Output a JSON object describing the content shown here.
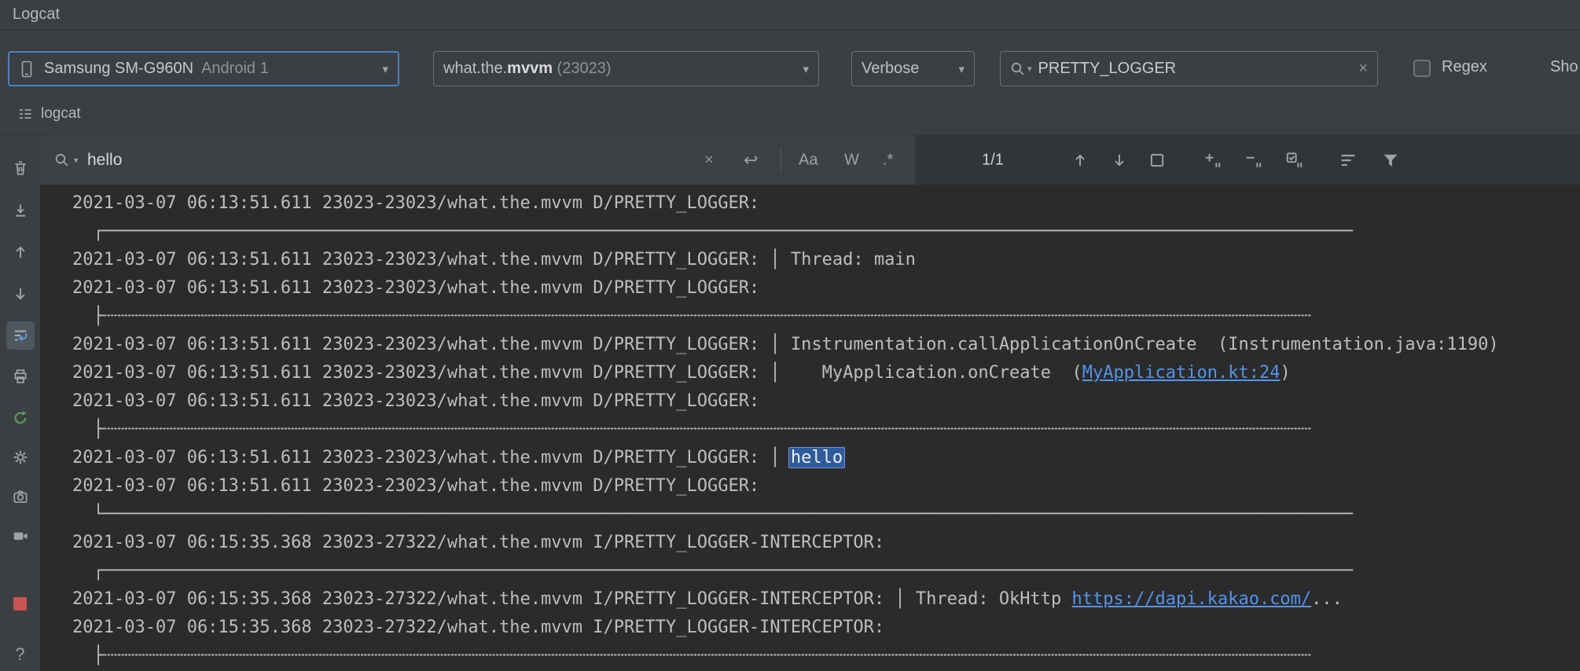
{
  "window": {
    "title": "Logcat"
  },
  "toolbar": {
    "device": {
      "name": "Samsung SM-G960N",
      "detail": "Android 1"
    },
    "process": {
      "package_prefix": "what.the.",
      "package_bold": "mvvm",
      "pid": " (23023)"
    },
    "log_level": "Verbose",
    "search_value": "PRETTY_LOGGER",
    "regex_label": "Regex",
    "clipped_label": "Sho"
  },
  "tab": {
    "label": "logcat"
  },
  "find_bar": {
    "query": "hello",
    "match_case": "Aa",
    "words": "W",
    "regex": ".*",
    "count": "1/1",
    "multiline": "↩"
  },
  "left_toolbar": {
    "help": "?"
  },
  "icons": {
    "dropdown_arrow": "▾",
    "close": "×"
  },
  "log": {
    "lines": [
      [
        {
          "t": "2021-03-07 06:13:51.611 23023-23023/what.the.mvvm D/PRETTY_LOGGER:"
        }
      ],
      [
        {
          "t": "  ┌────────────────────────────────────────────────────────────────────────────────────────────────────────────────────────"
        }
      ],
      [
        {
          "t": "2021-03-07 06:13:51.611 23023-23023/what.the.mvvm D/PRETTY_LOGGER: │ Thread: main"
        }
      ],
      [
        {
          "t": "2021-03-07 06:13:51.611 23023-23023/what.the.mvvm D/PRETTY_LOGGER:"
        }
      ],
      [
        {
          "t": "  ├┄┄┄┄┄┄┄┄┄┄┄┄┄┄┄┄┄┄┄┄┄┄┄┄┄┄┄┄┄┄┄┄┄┄┄┄┄┄┄┄┄┄┄┄┄┄┄┄┄┄┄┄┄┄┄┄┄┄┄┄┄┄┄┄┄┄┄┄┄┄┄┄┄┄┄┄┄┄┄┄┄┄┄┄┄┄┄┄┄┄┄┄┄┄┄┄┄┄┄┄┄┄┄┄┄┄┄┄┄┄┄┄┄┄┄┄"
        }
      ],
      [
        {
          "t": "2021-03-07 06:13:51.611 23023-23023/what.the.mvvm D/PRETTY_LOGGER: │ Instrumentation.callApplicationOnCreate  (Instrumentation.java:1190)"
        }
      ],
      [
        {
          "t": "2021-03-07 06:13:51.611 23023-23023/what.the.mvvm D/PRETTY_LOGGER: │    MyApplication.onCreate  ("
        },
        {
          "t": "MyApplication.kt:24",
          "s": "link"
        },
        {
          "t": ")"
        }
      ],
      [
        {
          "t": "2021-03-07 06:13:51.611 23023-23023/what.the.mvvm D/PRETTY_LOGGER:"
        }
      ],
      [
        {
          "t": "  ├┄┄┄┄┄┄┄┄┄┄┄┄┄┄┄┄┄┄┄┄┄┄┄┄┄┄┄┄┄┄┄┄┄┄┄┄┄┄┄┄┄┄┄┄┄┄┄┄┄┄┄┄┄┄┄┄┄┄┄┄┄┄┄┄┄┄┄┄┄┄┄┄┄┄┄┄┄┄┄┄┄┄┄┄┄┄┄┄┄┄┄┄┄┄┄┄┄┄┄┄┄┄┄┄┄┄┄┄┄┄┄┄┄┄┄┄"
        }
      ],
      [
        {
          "t": "2021-03-07 06:13:51.611 23023-23023/what.the.mvvm D/PRETTY_LOGGER: │ "
        },
        {
          "t": "hello",
          "s": "hl"
        }
      ],
      [
        {
          "t": "2021-03-07 06:13:51.611 23023-23023/what.the.mvvm D/PRETTY_LOGGER:"
        }
      ],
      [
        {
          "t": "  └────────────────────────────────────────────────────────────────────────────────────────────────────────────────────────"
        }
      ],
      [
        {
          "t": "2021-03-07 06:15:35.368 23023-27322/what.the.mvvm I/PRETTY_LOGGER-INTERCEPTOR:"
        }
      ],
      [
        {
          "t": "  ┌────────────────────────────────────────────────────────────────────────────────────────────────────────────────────────"
        }
      ],
      [
        {
          "t": "2021-03-07 06:15:35.368 23023-27322/what.the.mvvm I/PRETTY_LOGGER-INTERCEPTOR: │ Thread: OkHttp "
        },
        {
          "t": "https://dapi.kakao.com/",
          "s": "link"
        },
        {
          "t": "..."
        }
      ],
      [
        {
          "t": "2021-03-07 06:15:35.368 23023-27322/what.the.mvvm I/PRETTY_LOGGER-INTERCEPTOR:"
        }
      ],
      [
        {
          "t": "  ├┄┄┄┄┄┄┄┄┄┄┄┄┄┄┄┄┄┄┄┄┄┄┄┄┄┄┄┄┄┄┄┄┄┄┄┄┄┄┄┄┄┄┄┄┄┄┄┄┄┄┄┄┄┄┄┄┄┄┄┄┄┄┄┄┄┄┄┄┄┄┄┄┄┄┄┄┄┄┄┄┄┄┄┄┄┄┄┄┄┄┄┄┄┄┄┄┄┄┄┄┄┄┄┄┄┄┄┄┄┄┄┄┄┄┄┄"
        }
      ]
    ]
  }
}
